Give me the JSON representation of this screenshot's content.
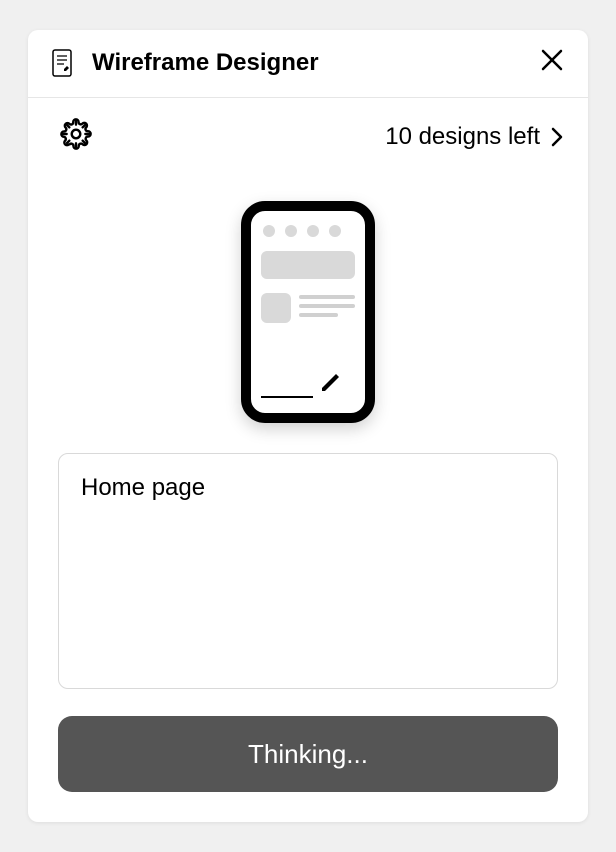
{
  "header": {
    "title": "Wireframe Designer"
  },
  "toolbar": {
    "designs_left_label": "10 designs left"
  },
  "input": {
    "value": "Home page",
    "placeholder": ""
  },
  "footer": {
    "button_label": "Thinking..."
  }
}
